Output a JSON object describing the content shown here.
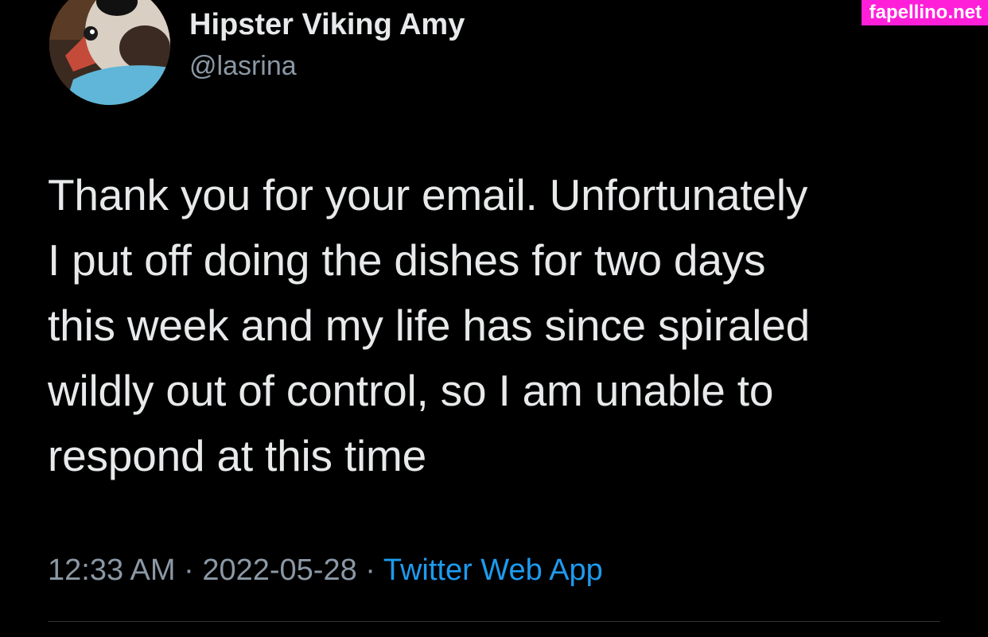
{
  "watermark": {
    "text": "fapellino.net",
    "color": "#ff1fd9"
  },
  "author": {
    "display_name": "Hipster Viking Amy",
    "handle": "@lasrina",
    "avatar_icon": "dog-avatar-icon"
  },
  "tweet": {
    "lines": [
      "Thank you for your email. Unfortunately",
      "I put off doing the dishes for two days",
      "this week and my life has since spiraled",
      "wildly out of control, so I am unable to",
      "respond at this time"
    ],
    "time": "12:33 AM",
    "separator": " · ",
    "date": "2022-05-28",
    "source": "Twitter Web App"
  },
  "colors": {
    "background": "#000000",
    "text": "#e7e9ea",
    "secondary": "#8b98a5",
    "link": "#1d9bf0"
  }
}
